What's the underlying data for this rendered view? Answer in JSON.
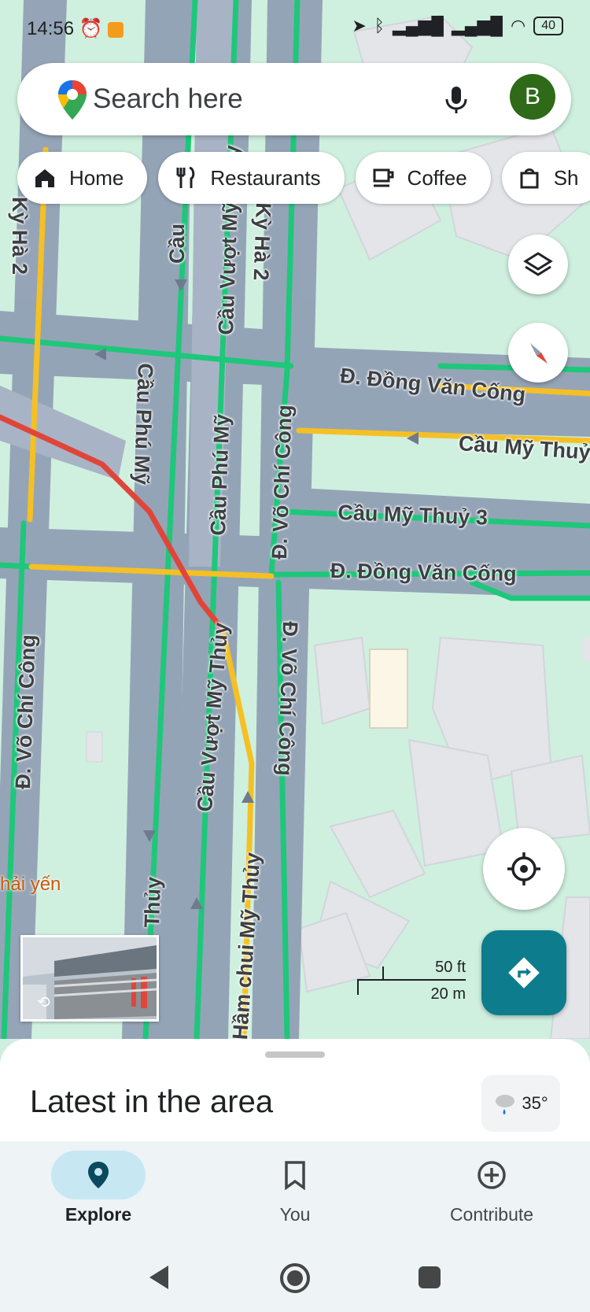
{
  "status_bar": {
    "time": "14:56",
    "battery": "40"
  },
  "search": {
    "placeholder": "Search here",
    "avatar_letter": "B"
  },
  "chips": [
    {
      "label": "Home",
      "icon": "home-icon"
    },
    {
      "label": "Restaurants",
      "icon": "fork-knife-icon"
    },
    {
      "label": "Coffee",
      "icon": "coffee-cup-icon"
    },
    {
      "label": "Sh",
      "icon": "shopping-bag-icon"
    }
  ],
  "map": {
    "roads": [
      "Kỳ Hà 2",
      "Cầu Phú Mỹ",
      "Cầu Vượt Mỹ Thủy",
      "Kỳ Hà 2",
      "Đ. Đồng Văn Cống",
      "Cầu Mỹ Thuỷ",
      "Cầu Phú Mỹ",
      "Cầu Phú Mỹ",
      "Đ. Võ Chí Công",
      "Cầu Mỹ Thuỷ 3",
      "Đ. Đồng Văn Cống",
      "Cầu Vượt Mỹ Thủy",
      "Đ. Võ Chí Công",
      "Đ. Võ Chí Công",
      "Hầm chui Mỹ Thủy",
      "Thủy",
      "Cầu"
    ],
    "poi": "hải yến",
    "scale_ft": "50 ft",
    "scale_m": "20 m"
  },
  "sheet": {
    "title": "Latest in the area",
    "weather_temp": "35°"
  },
  "bottom_nav": [
    {
      "label": "Explore",
      "icon": "location-pin-icon",
      "active": true
    },
    {
      "label": "You",
      "icon": "bookmark-icon",
      "active": false
    },
    {
      "label": "Contribute",
      "icon": "add-circle-icon",
      "active": false
    }
  ],
  "colors": {
    "accent_teal": "#0d7c8c",
    "avatar_green": "#2e6a17",
    "traffic_green": "#1ec77a",
    "traffic_yellow": "#f5c024",
    "traffic_red": "#e0453a"
  }
}
